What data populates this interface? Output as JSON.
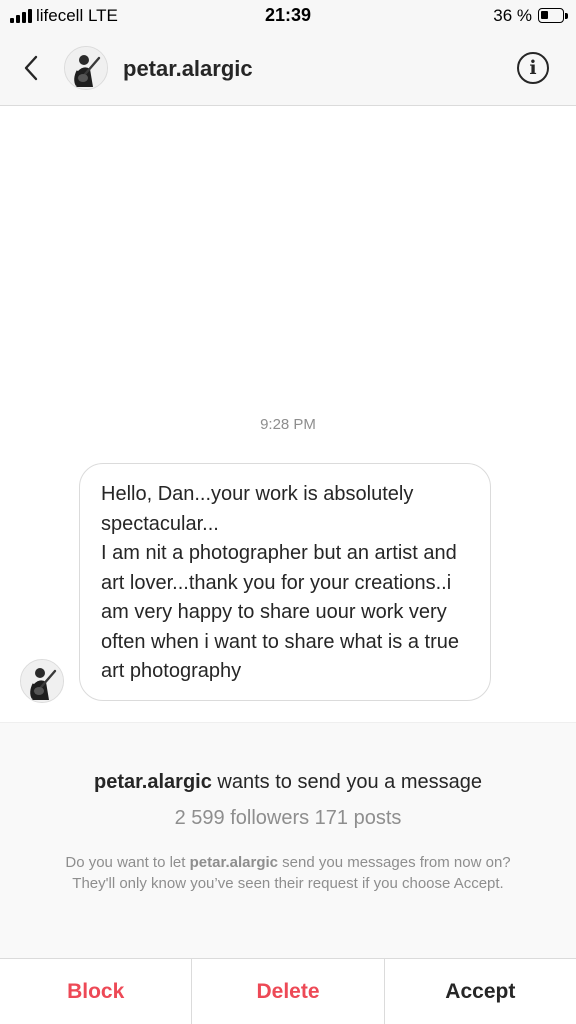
{
  "status_bar": {
    "carrier": "lifecell  LTE",
    "time": "21:39",
    "battery_percent_label": "36 %",
    "battery_level": 0.36
  },
  "header": {
    "username": "petar.alargic",
    "avatar_icon": "guitarist-avatar-icon",
    "back_icon": "chevron-left-icon",
    "info_icon": "info-icon",
    "info_glyph": "i"
  },
  "conversation": {
    "timestamp": "9:28 PM",
    "messages": [
      {
        "sender": "petar.alargic",
        "text": "Hello, Dan...your work is absolutely spectacular...\nI am nit a photographer but an artist and art lover...thank you for your creations..i am very happy to share uour work very often when i want to share what is a true art photography"
      }
    ]
  },
  "request": {
    "username": "petar.alargic",
    "title_suffix": " wants to send you a message",
    "stats": "2 599 followers 171 posts",
    "note_prefix": "Do you want to let ",
    "note_username": "petar.alargic",
    "note_suffix": " send you messages from now on? They'll only know you’ve seen their request if you choose Accept."
  },
  "actions": {
    "block_label": "Block",
    "delete_label": "Delete",
    "accept_label": "Accept"
  },
  "colors": {
    "destructive": "#ed4956",
    "text": "#262626",
    "secondary_text": "#8e8e8e",
    "border": "#dbdbdb"
  }
}
